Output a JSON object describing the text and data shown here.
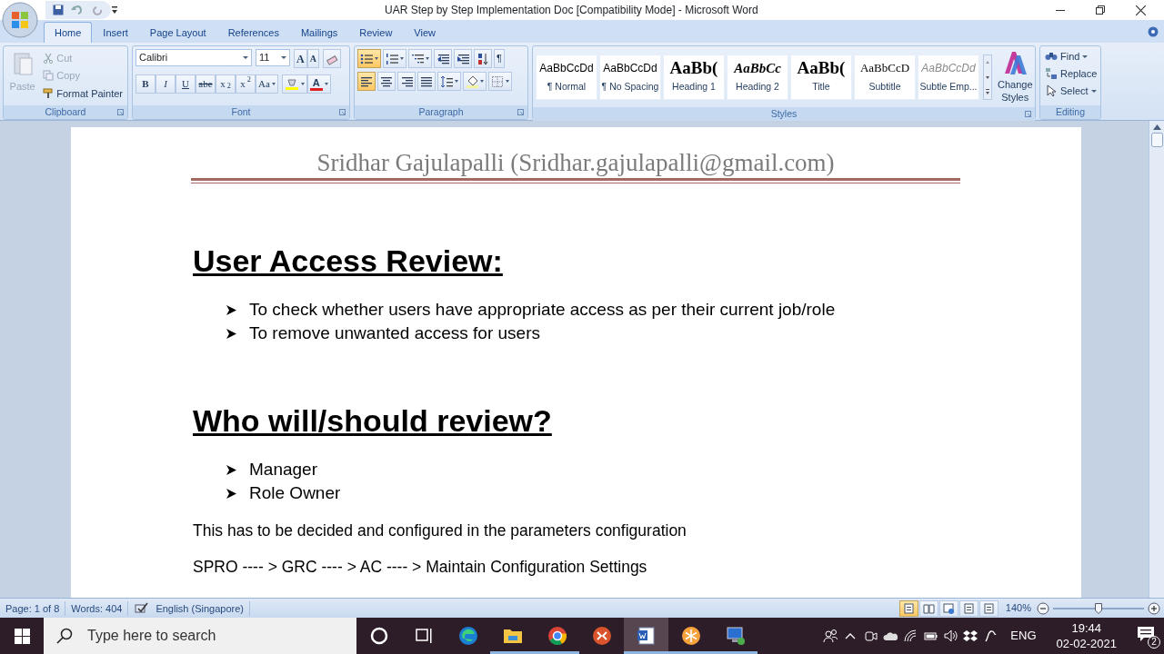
{
  "window": {
    "title": "UAR Step by Step Implementation Doc [Compatibility Mode] - Microsoft Word"
  },
  "tabs": [
    {
      "label": "Home",
      "selected": true
    },
    {
      "label": "Insert",
      "selected": false
    },
    {
      "label": "Page Layout",
      "selected": false
    },
    {
      "label": "References",
      "selected": false
    },
    {
      "label": "Mailings",
      "selected": false
    },
    {
      "label": "Review",
      "selected": false
    },
    {
      "label": "View",
      "selected": false
    }
  ],
  "ribbon": {
    "clipboard": {
      "label": "Clipboard",
      "paste": {
        "label": "Paste",
        "disabled": true
      },
      "small": [
        {
          "kind": "cut",
          "label": "Cut",
          "disabled": true
        },
        {
          "kind": "copy",
          "label": "Copy",
          "disabled": true
        },
        {
          "kind": "format_painter",
          "label": "Format Painter",
          "disabled": false
        }
      ]
    },
    "font": {
      "label": "Font",
      "font_name": "Calibri",
      "font_size": "11",
      "top": [
        {
          "kind": "grow",
          "label": "A"
        },
        {
          "kind": "shrink",
          "label": "A"
        },
        {
          "kind": "clear"
        }
      ],
      "bottom": [
        {
          "kind": "bold",
          "label": "B"
        },
        {
          "kind": "italic",
          "label": "I"
        },
        {
          "kind": "underline",
          "label": "U"
        },
        {
          "kind": "strike",
          "label": "abe"
        },
        {
          "kind": "plain",
          "label": "x$_{2}$"
        },
        {
          "kind": "plain",
          "label": "x$^{2}$"
        },
        {
          "kind": "case",
          "label": "Aa"
        },
        {
          "kind": "highlight"
        },
        {
          "kind": "color",
          "label": "A"
        }
      ]
    },
    "paragraph": {
      "label": "Paragraph",
      "rows": [
        [
          {
            "kind": "bullets",
            "selected": true
          },
          {
            "kind": "numbering",
            "selected": false
          },
          {
            "kind": "multilevel",
            "selected": false
          },
          {
            "kind": "outdent",
            "selected": false
          },
          {
            "kind": "indent",
            "selected": false
          },
          {
            "kind": "sort",
            "selected": false
          },
          {
            "kind": "marks",
            "label": "¶",
            "selected": false
          }
        ],
        [
          {
            "kind": "align_left",
            "selected": true
          },
          {
            "kind": "align_center",
            "selected": false
          },
          {
            "kind": "align_right",
            "selected": false
          },
          {
            "kind": "justify",
            "selected": false
          },
          {
            "kind": "spacing",
            "selected": false
          },
          {
            "kind": "shading",
            "selected": false
          },
          {
            "kind": "borders",
            "selected": false
          }
        ]
      ]
    },
    "styles": {
      "label": "Styles",
      "gallery": [
        {
          "kind": "normal",
          "preview": "AaBbCcDd",
          "name": "¶ Normal"
        },
        {
          "kind": "normal",
          "preview": "AaBbCcDd",
          "name": "¶ No Spacing"
        },
        {
          "kind": "heading1",
          "preview": "AaBb(",
          "name": "Heading 1"
        },
        {
          "kind": "heading2",
          "preview": "AaBbCc",
          "name": "Heading 2"
        },
        {
          "kind": "title",
          "preview": "AaBb(",
          "name": "Title"
        },
        {
          "kind": "subtitle",
          "preview": "AaBbCcD",
          "name": "Subtitle"
        },
        {
          "kind": "subtle",
          "preview": "AaBbCcDd",
          "name": "Subtle Emp..."
        }
      ],
      "change_styles": "Change Styles"
    },
    "editing": {
      "label": "Editing",
      "buttons": [
        {
          "kind": "find",
          "label": "Find"
        },
        {
          "kind": "replace",
          "label": "Replace"
        },
        {
          "kind": "select",
          "label": "Select"
        }
      ]
    }
  },
  "document": {
    "header": "Sridhar Gajulapalli (Sridhar.gajulapalli@gmail.com)",
    "blocks": [
      {
        "kind": "heading",
        "text": "User Access Review:"
      },
      {
        "kind": "bullets",
        "items": [
          "To check whether users have appropriate access as per their current job/role",
          "To remove unwanted access for users"
        ]
      },
      {
        "kind": "heading",
        "text": "Who will/should review?"
      },
      {
        "kind": "bullets",
        "items": [
          "Manager",
          "Role Owner"
        ]
      },
      {
        "kind": "paragraph",
        "text": "This has to be decided and configured in the parameters configuration"
      },
      {
        "kind": "paragraph",
        "text": "SPRO ---- > GRC ---- > AC ---- > Maintain Configuration Settings"
      }
    ]
  },
  "status_bar": {
    "page": "Page: 1 of 8",
    "words": "Words: 404",
    "language": "English (Singapore)",
    "views": [
      {
        "kind": "print",
        "selected": true
      },
      {
        "kind": "reading",
        "selected": false
      },
      {
        "kind": "web",
        "selected": false
      },
      {
        "kind": "outline",
        "selected": false
      },
      {
        "kind": "draft",
        "selected": false
      }
    ],
    "zoom": "140%",
    "zoom_slider": {
      "level": 0.5
    }
  },
  "taskbar": {
    "search": {
      "placeholder": "Type here to search"
    },
    "apps": [
      {
        "kind": "cortana",
        "running": false,
        "active": false
      },
      {
        "kind": "taskview",
        "running": false,
        "active": false
      },
      {
        "kind": "edge",
        "running": false,
        "active": false
      },
      {
        "kind": "explorer",
        "running": true,
        "active": false
      },
      {
        "kind": "chrome",
        "running": true,
        "active": false
      },
      {
        "kind": "remote",
        "running": false,
        "active": false
      },
      {
        "kind": "word",
        "running": true,
        "active": true
      },
      {
        "kind": "snowflake",
        "running": true,
        "active": false
      },
      {
        "kind": "computer",
        "running": true,
        "active": false
      }
    ],
    "language": "ENG",
    "time": "19:44",
    "date": "02-02-2021",
    "notifications": "2"
  }
}
